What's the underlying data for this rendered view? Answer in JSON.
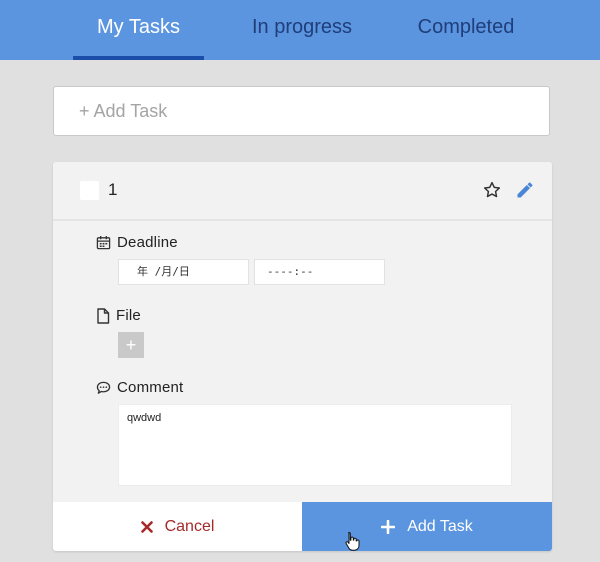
{
  "tabs": [
    {
      "label": "My Tasks",
      "active": true
    },
    {
      "label": "In progress",
      "active": false
    },
    {
      "label": "Completed",
      "active": false
    }
  ],
  "add_task": {
    "placeholder": "+ Add Task"
  },
  "task": {
    "title": "1",
    "checked": false,
    "deadline": {
      "label": "Deadline",
      "date_placeholder": "年 /月/日",
      "time_placeholder": "----:--"
    },
    "file": {
      "label": "File",
      "add_label": "+"
    },
    "comment": {
      "label": "Comment",
      "value": "qwdwd"
    }
  },
  "actions": {
    "cancel_label": "Cancel",
    "add_label": "Add Task"
  },
  "icons": {
    "checkbox": "checkbox-icon",
    "star": "star-outline-icon",
    "edit": "pencil-icon",
    "calendar": "calendar-icon",
    "file": "file-icon",
    "comment": "comment-icon",
    "cancel": "x-icon",
    "add": "plus-icon",
    "cursor": "hand-pointer-icon"
  },
  "colors": {
    "accent": "#5b95e0",
    "tab_inactive_text": "#1f3e7a",
    "tab_underline": "#1b4ea8",
    "cancel_text": "#a52a2a",
    "background": "#e0e0e0",
    "card": "#f2f2f2"
  }
}
